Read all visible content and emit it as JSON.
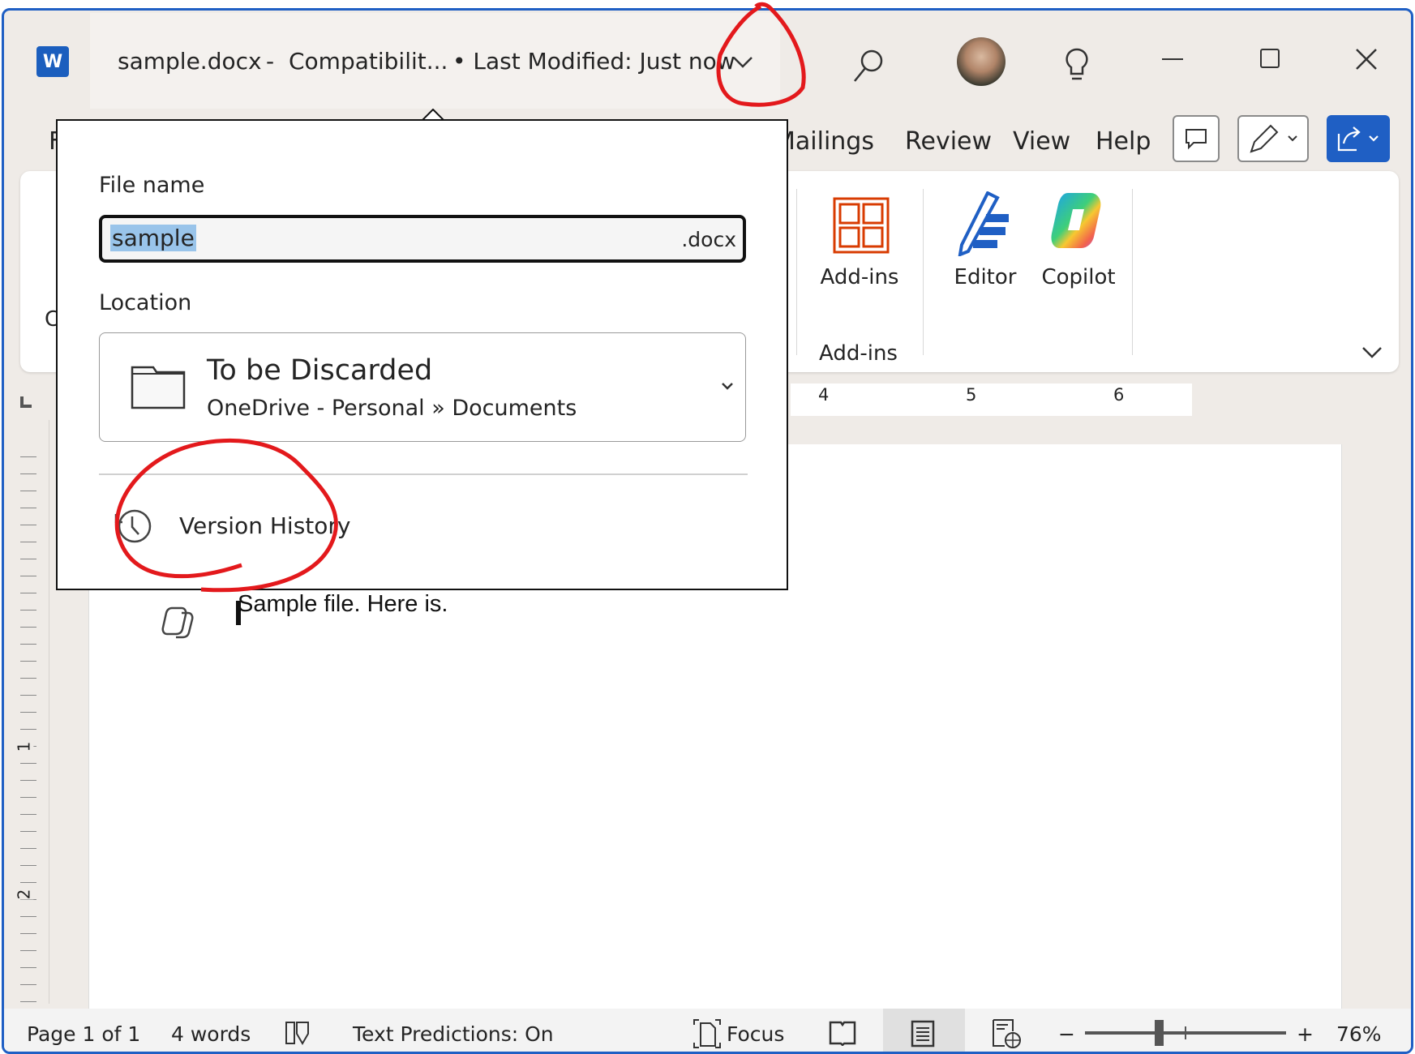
{
  "titlebar": {
    "filename": "sample.docx",
    "separator": "-",
    "mode": "Compatibilit...",
    "modified": "• Last Modified: Just now",
    "app_icon_letter": "W"
  },
  "tabs": [
    {
      "label": "F"
    },
    {
      "label": "Mailings"
    },
    {
      "label": "Review"
    },
    {
      "label": "View"
    },
    {
      "label": "Help"
    }
  ],
  "ribbon": {
    "left_partial": "C",
    "addins_label": "Add-ins",
    "editor_label": "Editor",
    "copilot_label": "Copilot",
    "group_label": "Add-ins"
  },
  "ruler": {
    "h_numbers": [
      "4",
      "5",
      "6"
    ],
    "v_numbers": [
      "1",
      "2"
    ]
  },
  "document": {
    "text": "Sample file.  Here is."
  },
  "popup": {
    "file_name_label": "File name",
    "file_name_value": "sample",
    "extension": ".docx",
    "location_label": "Location",
    "location_title": "To be Discarded",
    "location_path": "OneDrive - Personal » Documents",
    "version_history": "Version History"
  },
  "status": {
    "page": "Page 1 of 1",
    "words": "4 words",
    "text_predictions": "Text Predictions: On",
    "focus": "Focus",
    "zoom_minus": "−",
    "zoom_plus": "+",
    "zoom": "76%",
    "zoom_percent": 76
  },
  "colors": {
    "accent": "#1f5fc4",
    "annotation": "#e3191c",
    "selection": "#99c4ea"
  }
}
